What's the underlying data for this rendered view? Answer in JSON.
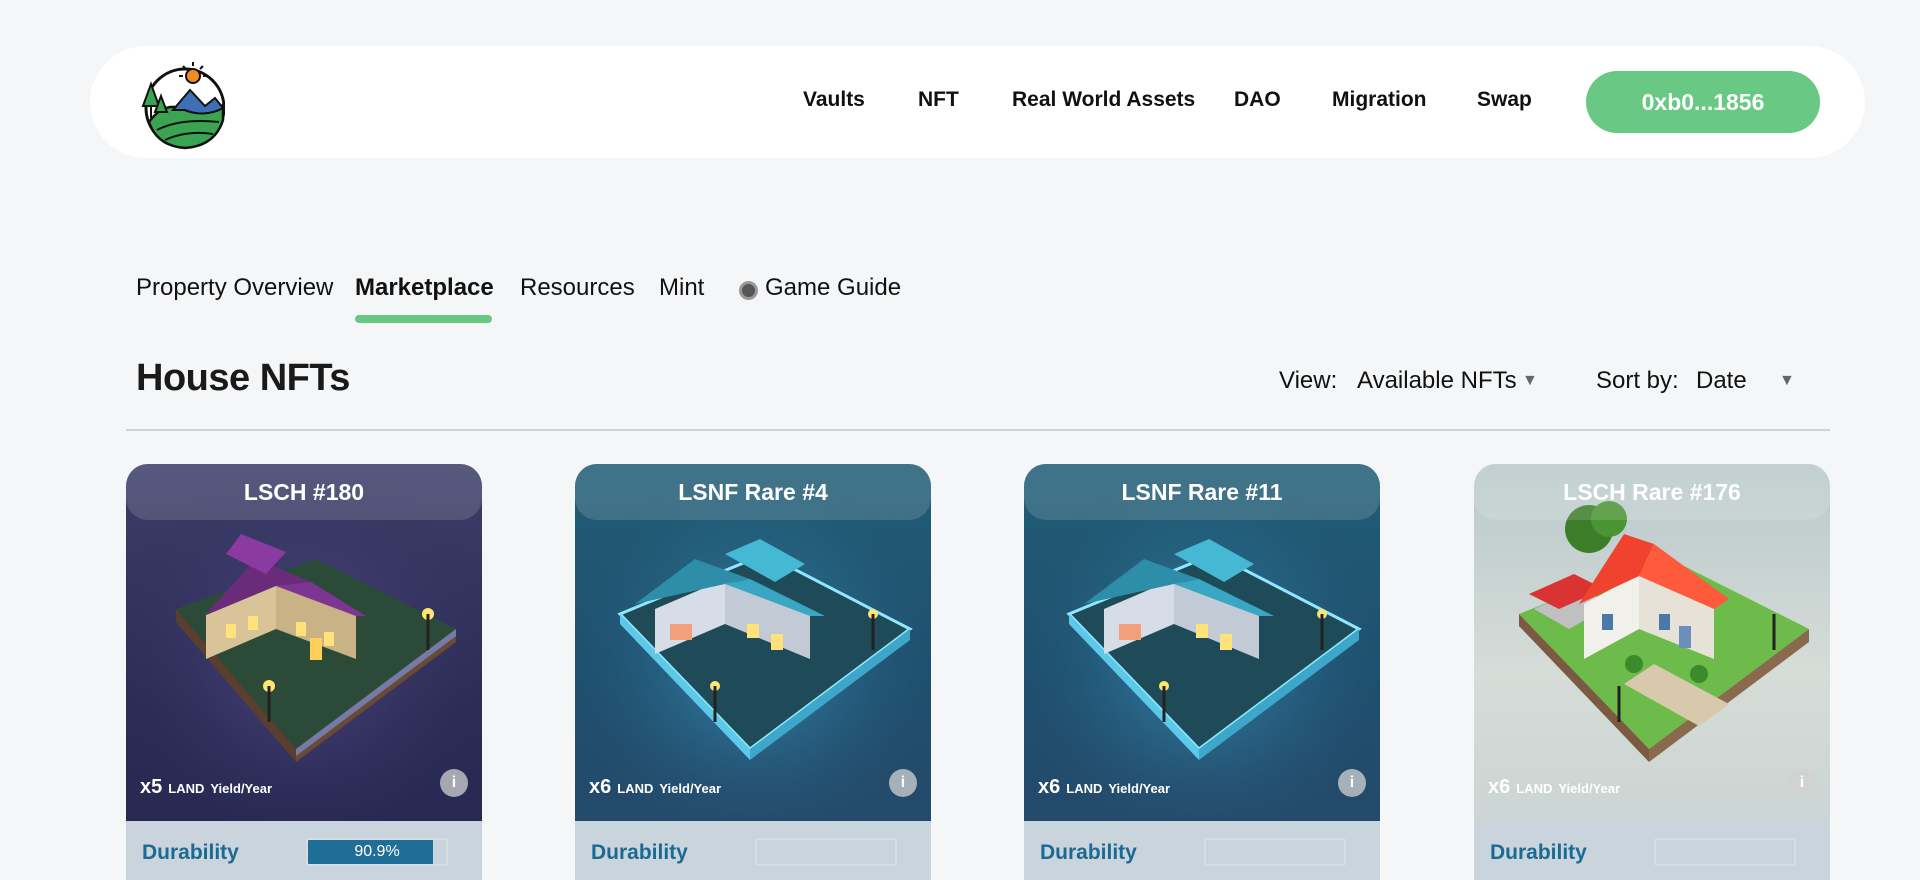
{
  "header": {
    "nav": [
      "Vaults",
      "NFT",
      "Real World Assets",
      "DAO",
      "Migration",
      "Swap"
    ],
    "wallet": "0xb0...1856"
  },
  "tabs": [
    "Property Overview",
    "Marketplace",
    "Resources",
    "Mint",
    "Game Guide"
  ],
  "active_tab": "Marketplace",
  "section": {
    "title": "House NFTs",
    "view_label": "View:",
    "view_value": "Available NFTs",
    "sort_label": "Sort by:",
    "sort_value": "Date"
  },
  "cards": [
    {
      "title": "LSCH #180",
      "multiplier": "x5",
      "token": "LAND",
      "yield_label": "Yield/Year",
      "durability_label": "Durability",
      "durability_text": "90.9%",
      "durability": 0.909
    },
    {
      "title": "LSNF Rare #4",
      "multiplier": "x6",
      "token": "LAND",
      "yield_label": "Yield/Year",
      "durability_label": "Durability"
    },
    {
      "title": "LSNF Rare #11",
      "multiplier": "x6",
      "token": "LAND",
      "yield_label": "Yield/Year",
      "durability_label": "Durability"
    },
    {
      "title": "LSCH Rare #176",
      "multiplier": "x6",
      "token": "LAND",
      "yield_label": "Yield/Year",
      "durability_label": "Durability"
    }
  ],
  "colors": {
    "accent": "#69c883",
    "durability": "#1f6e98"
  }
}
